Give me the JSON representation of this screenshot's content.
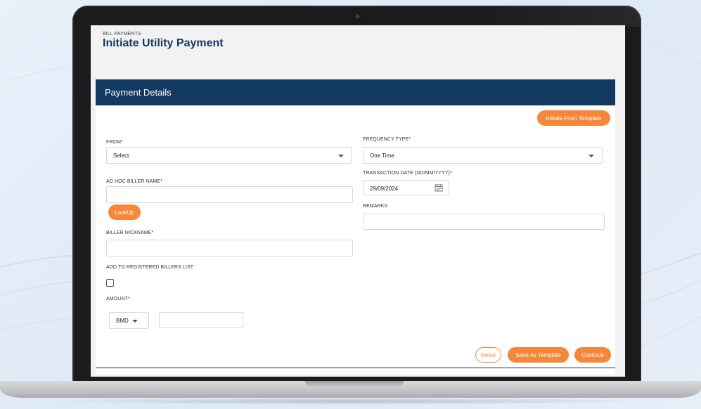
{
  "header": {
    "breadcrumb": "BILL PAYMENTS",
    "title": "Initiate Utility Payment"
  },
  "card": {
    "title": "Payment Details",
    "initiate_from_template_label": "Initiate From Template"
  },
  "form": {
    "from": {
      "label": "FROM*",
      "value": "Select"
    },
    "ad_hoc_biller_name": {
      "label": "AD HOC BILLER NAME*",
      "value": ""
    },
    "lookup_label": "LookUp",
    "biller_nickname": {
      "label": "BILLER NICKNAME*",
      "value": ""
    },
    "add_to_registered": {
      "label": "ADD TO REGISTERED BILLERS LIST",
      "checked": false
    },
    "amount": {
      "label": "AMOUNT*",
      "currency": "BMD",
      "value": ""
    },
    "frequency_type": {
      "label": "FREQUENCY TYPE*",
      "value": "One Time"
    },
    "transaction_date": {
      "label": "TRANSACTION DATE (DD/MM/YYYY)*",
      "value": "29/09/2024"
    },
    "remarks": {
      "label": "REMARKS",
      "value": ""
    }
  },
  "actions": {
    "reset_label": "Reset",
    "save_as_template_label": "Save As Template",
    "continue_label": "Continue"
  },
  "colors": {
    "accent": "#f5873a",
    "header": "#12395f",
    "title": "#163a63"
  },
  "icons": {
    "dropdown": "chevron-down-icon",
    "date": "calendar-icon"
  }
}
